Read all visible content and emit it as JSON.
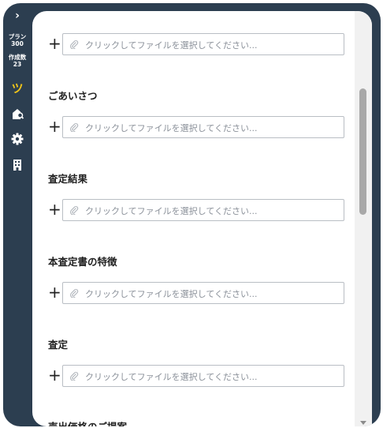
{
  "sidebar": {
    "expand_glyph": "›",
    "plan_label": "プラン",
    "plan_value": "300",
    "created_label": "作成数",
    "created_value": "23",
    "logo_letter": "ツ",
    "icons": [
      "chevron-right-icon",
      "house-search-icon",
      "gear-icon",
      "building-icon"
    ],
    "accent_color": "#f0c419"
  },
  "upload": {
    "plus_glyph": "+",
    "placeholder": "クリックしてファイルを選択してください..."
  },
  "sections": [
    {
      "title": ""
    },
    {
      "title": "ごあいさつ"
    },
    {
      "title": "査定結果"
    },
    {
      "title": "本査定書の特徴"
    },
    {
      "title": "査定"
    },
    {
      "title": "売出価格のご提案"
    }
  ]
}
